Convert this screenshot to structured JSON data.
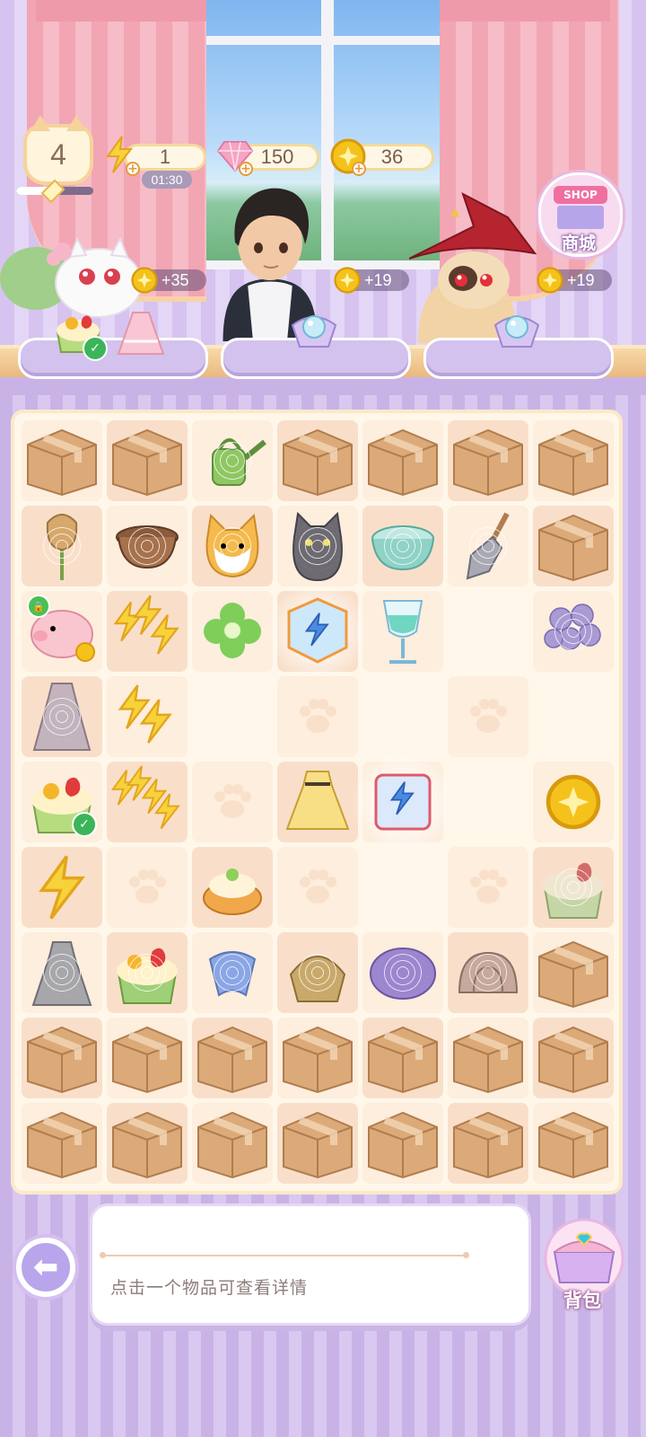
{
  "player": {
    "level": "4",
    "xp_progress": 0.45
  },
  "resources": {
    "energy": {
      "value": "1",
      "timer": "01:30",
      "icon": "lightning-icon"
    },
    "gems": {
      "value": "150",
      "icon": "gem-icon"
    },
    "coins": {
      "value": "36",
      "icon": "coin-icon"
    }
  },
  "shop": {
    "sign": "SHOP",
    "label": "商城"
  },
  "customers": [
    {
      "name": "white-cat",
      "reward": "+35"
    },
    {
      "name": "boy",
      "reward": "+19"
    },
    {
      "name": "witch-cat",
      "reward": "+19"
    }
  ],
  "board": {
    "rows": [
      [
        "box",
        "box",
        "watering-can",
        "box",
        "box",
        "box",
        "box"
      ],
      [
        "tulip",
        "pot",
        "cat-orange",
        "cat-gray",
        "bowl",
        "shovel",
        "box"
      ],
      [
        "piggy-bank",
        "energy-3",
        "clover",
        "energy-block",
        "goblet",
        "empty",
        "hydrangea"
      ],
      [
        "dress-gray",
        "energy-2",
        "empty",
        "paw",
        "empty",
        "paw",
        "empty"
      ],
      [
        "cake",
        "energy-4",
        "paw",
        "dress-yellow",
        "energy-chest",
        "empty",
        "coin"
      ],
      [
        "energy-1",
        "paw",
        "pastry",
        "paw",
        "empty",
        "paw",
        "cake-ghost"
      ],
      [
        "ghost-dress",
        "cake-green",
        "ribbon",
        "bag",
        "cushion",
        "shell",
        "box"
      ],
      [
        "box",
        "box",
        "box",
        "box",
        "box",
        "box",
        "box"
      ],
      [
        "box",
        "box",
        "box",
        "box",
        "box",
        "box",
        "box"
      ]
    ]
  },
  "info_panel": {
    "hint": "点击一个物品可查看详情"
  },
  "bag": {
    "label": "背包"
  },
  "colors": {
    "accent": "#c9b3e6",
    "coin": "#f5c21b",
    "box": "#d9a574"
  }
}
